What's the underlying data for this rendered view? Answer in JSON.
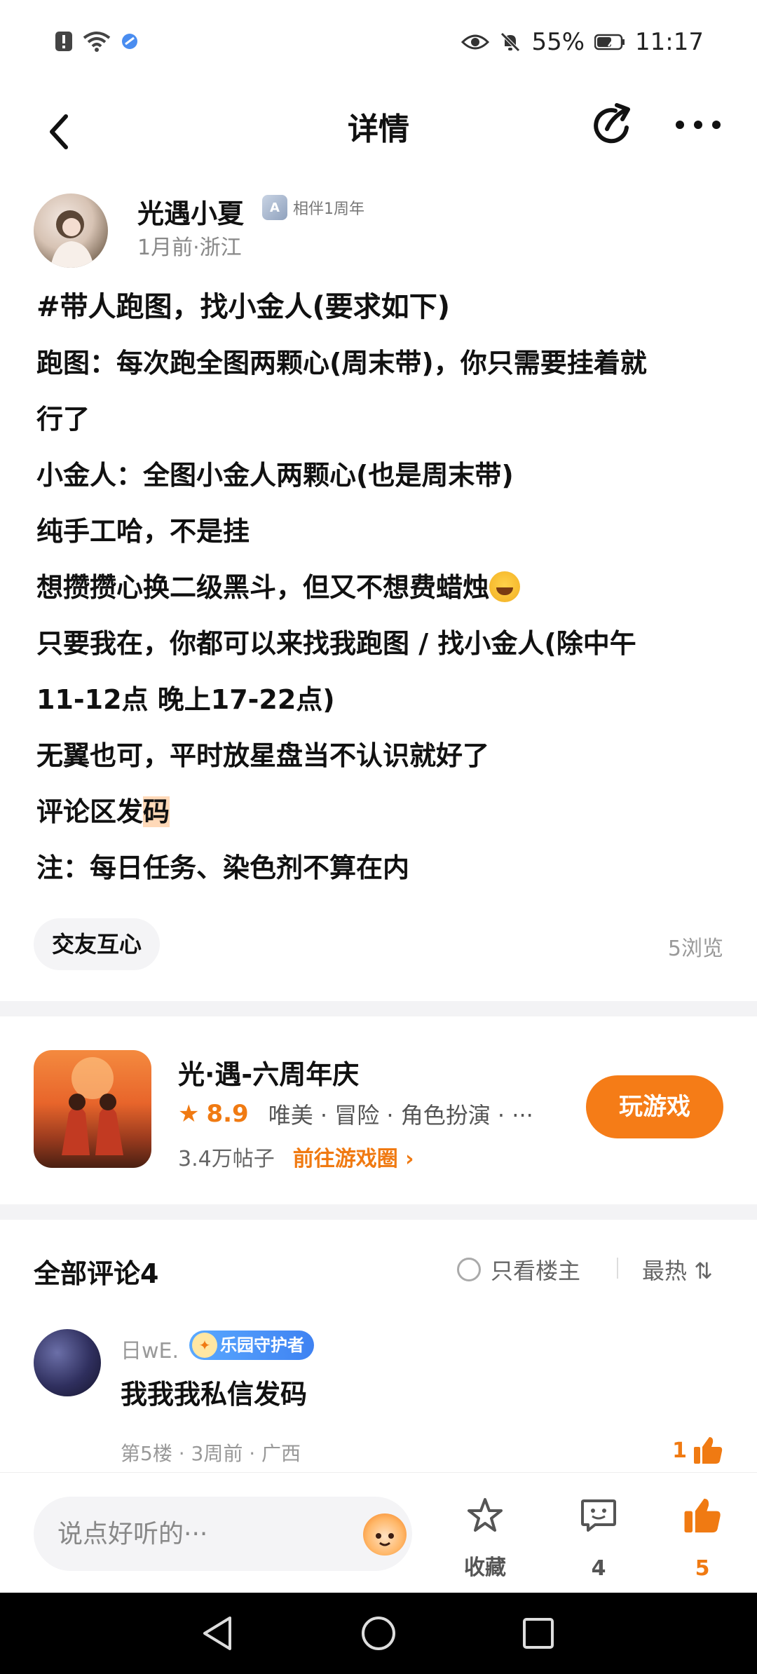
{
  "status_bar": {
    "battery": "55%",
    "time": "11:17"
  },
  "header": {
    "title": "详情"
  },
  "author": {
    "name": "光遇小夏",
    "badge": "相伴1周年",
    "meta": "1月前·浙江"
  },
  "post": {
    "lines": [
      "#带人跑图，找小金人(要求如下)",
      "跑图：每次跑全图两颗心(周末带)，你只需要挂着就",
      "行了",
      "小金人：全图小金人两颗心(也是周末带)",
      "纯手工哈，不是挂",
      "想攒攒心换二级黑斗，但又不想费蜡烛",
      "只要我在，你都可以来找我跑图 / 找小金人(除中午",
      "11-12点 晚上17-22点)",
      "无翼也可，平时放星盘当不认识就好了",
      "评论区发",
      "码",
      "注：每日任务、染色剂不算在内"
    ],
    "tag": "交友互心",
    "views": "5浏览"
  },
  "game": {
    "name": "光·遇-六周年庆",
    "rating": "8.9",
    "tags": "唯美 · 冒险 · 角色扮演 · ···",
    "posts": "3.4万帖子",
    "goto_label": "前往游戏圈 ›",
    "play_label": "玩游戏"
  },
  "comments": {
    "title": "全部评论4",
    "op_only": "只看楼主",
    "sort": "最热 ⇅",
    "items": [
      {
        "name": "日wE.",
        "badge": "乐园守护者",
        "text": "我我我私信发码",
        "meta": "第5楼 · 3周前 · 广西",
        "likes": "1"
      }
    ]
  },
  "bottom_bar": {
    "placeholder": "说点好听的···",
    "favorite_label": "收藏",
    "comment_count": "4",
    "like_count": "5"
  },
  "colors": {
    "accent": "#f57c17",
    "text": "#111111",
    "muted": "#999999"
  }
}
